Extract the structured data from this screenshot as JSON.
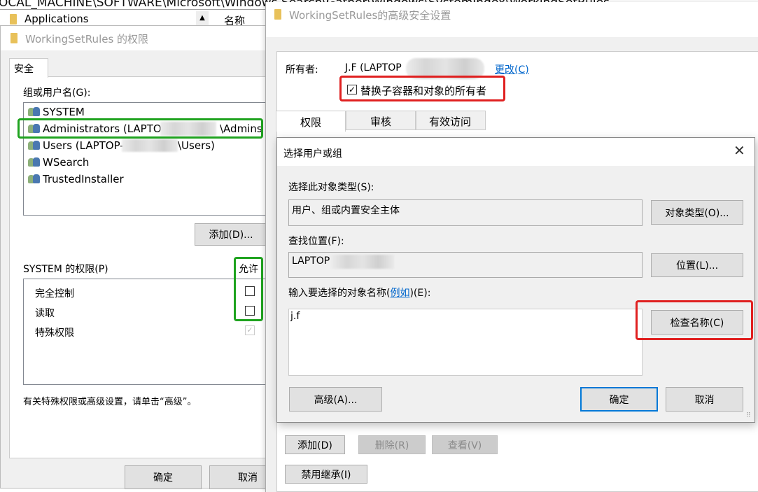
{
  "background": {
    "path": "OCAL_MACHINE\\SOFTWARE\\Microsoft\\Windows Search\\Gather\\Windows\\SystemIndex\\WorkingSetRules",
    "tree_item": "Applications",
    "column_header": "名称"
  },
  "perm_dialog": {
    "title": "WorkingSetRules 的权限",
    "tab": "安全",
    "group_label": "组或用户名(G):",
    "users": [
      "SYSTEM",
      "Administrators (LAPTOP",
      "\\Admins",
      "Users (LAPTOP-",
      "\\Users)",
      "WSearch",
      "TrustedInstaller"
    ],
    "add_button": "添加(D)...",
    "perm_label": "SYSTEM 的权限(P)",
    "allow_header": "允许",
    "permissions": [
      {
        "name": "完全控制",
        "allow": false
      },
      {
        "name": "读取",
        "allow": false
      },
      {
        "name": "特殊权限",
        "allow": true,
        "disabled": true
      }
    ],
    "help_text": "有关特殊权限或高级设置，请单击“高级”。",
    "ok": "确定",
    "cancel": "取消"
  },
  "adv_dialog": {
    "title": "WorkingSetRules的高级安全设置",
    "owner_label": "所有者:",
    "owner_value": "J.F (LAPTOP",
    "change_link": "更改(C)",
    "replace_owner": {
      "label": "替换子容器和对象的所有者",
      "checked": true
    },
    "tabs": [
      "权限",
      "审核",
      "有效访问"
    ],
    "active_tab": "权限",
    "add": "添加(D)",
    "remove": "删除(R)",
    "view": "查看(V)",
    "disable_inherit": "禁用继承(I)"
  },
  "select_dialog": {
    "title": "选择用户或组",
    "object_type_label": "选择此对象类型(S):",
    "object_type_value": "用户、组或内置安全主体",
    "object_type_button": "对象类型(O)...",
    "location_label": "查找位置(F):",
    "location_value": "LAPTOP",
    "location_button": "位置(L)...",
    "names_label_pre": "输入要选择的对象名称(",
    "names_label_link": "例如",
    "names_label_post": ")(E):",
    "names_value": "j.f",
    "check_names": "检查名称(C)",
    "advanced": "高级(A)...",
    "ok": "确定",
    "cancel": "取消"
  },
  "colors": {
    "highlight_red": "#e02020",
    "highlight_green": "#1fa31f",
    "link": "#0066cc",
    "default_button": "#0078d7"
  }
}
